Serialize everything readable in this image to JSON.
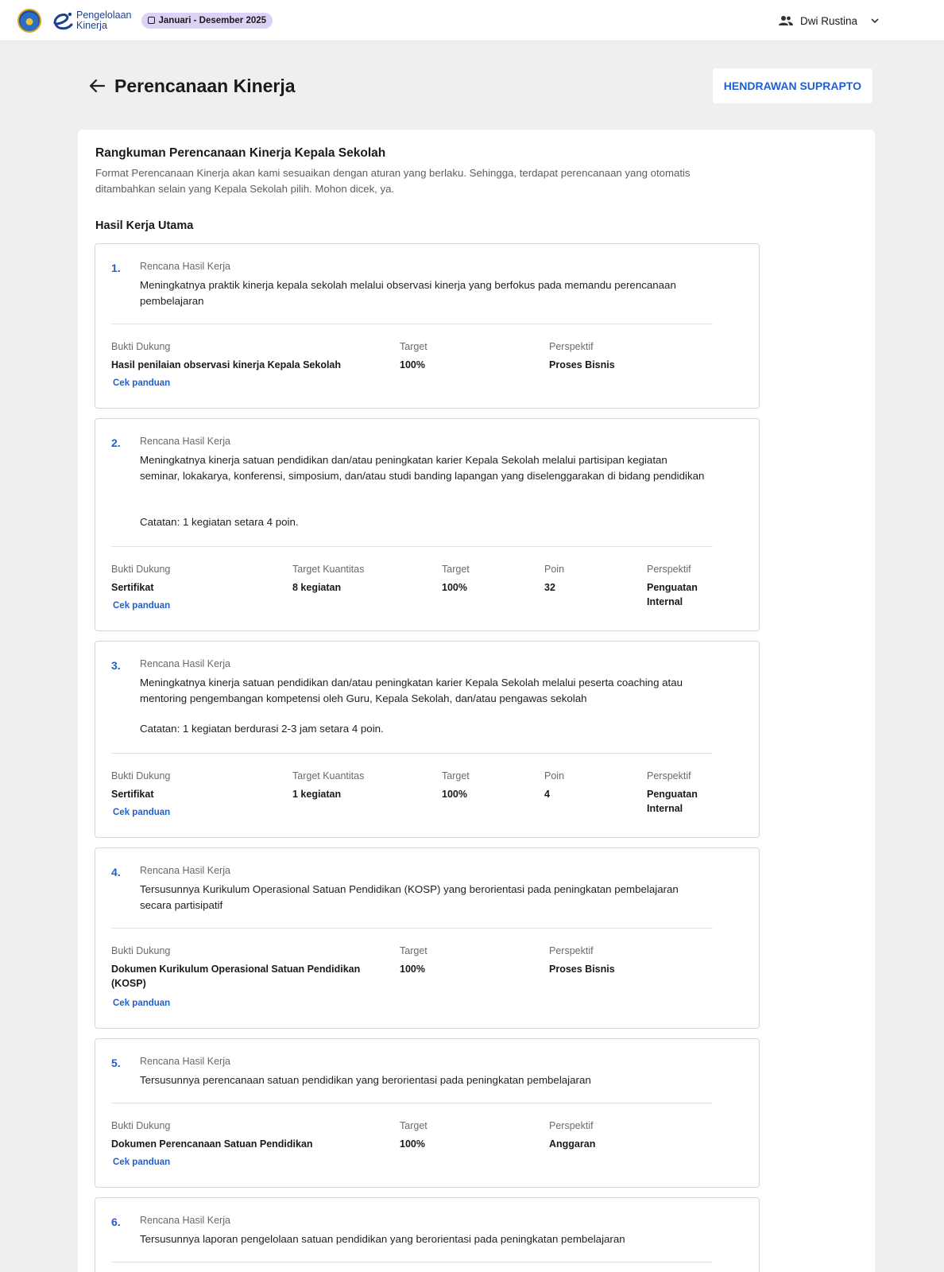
{
  "header": {
    "brand_line1": "Pengelolaan",
    "brand_line2": "Kinerja",
    "period": "Januari - Desember 2025",
    "user_name": "Dwi Rustina"
  },
  "page": {
    "title": "Perencanaan Kinerja",
    "assessee_button": "HENDRAWAN SUPRAPTO"
  },
  "summary": {
    "title": "Rangkuman Perencanaan Kinerja Kepala Sekolah",
    "description": "Format Perencanaan Kinerja akan kami sesuaikan dengan aturan yang berlaku. Sehingga, terdapat perencanaan yang otomatis ditambahkan selain yang Kepala Sekolah pilih. Mohon dicek, ya.",
    "section_title": "Hasil Kerja Utama"
  },
  "labels": {
    "plan": "Rencana Hasil Kerja",
    "evidence": "Bukti Dukung",
    "target_qty": "Target Kuantitas",
    "target": "Target",
    "points": "Poin",
    "perspective": "Perspektif",
    "guide": "Cek panduan"
  },
  "items": [
    {
      "number": "1.",
      "description": "Meningkatnya praktik kinerja kepala sekolah melalui observasi kinerja yang berfokus pada memandu perencanaan pembelajaran",
      "note": "",
      "evidence": "Hasil penilaian observasi kinerja Kepala Sekolah",
      "target_qty": "",
      "target": "100%",
      "points": "",
      "perspective": "Proses Bisnis"
    },
    {
      "number": "2.",
      "description": "Meningkatnya kinerja satuan pendidikan dan/atau peningkatan karier Kepala Sekolah melalui partisipan kegiatan seminar, lokakarya, konferensi, simposium, dan/atau studi banding lapangan yang diselenggarakan di bidang pendidikan",
      "note": "Catatan: 1 kegiatan setara 4 poin.",
      "evidence": "Sertifikat",
      "target_qty": "8 kegiatan",
      "target": "100%",
      "points": "32",
      "perspective": "Penguatan Internal"
    },
    {
      "number": "3.",
      "description": "Meningkatnya kinerja satuan pendidikan dan/atau peningkatan karier Kepala Sekolah melalui peserta coaching atau mentoring pengembangan kompetensi oleh Guru, Kepala Sekolah, dan/atau pengawas sekolah",
      "note": "Catatan: 1 kegiatan berdurasi 2-3 jam setara 4 poin.",
      "evidence": "Sertifikat",
      "target_qty": "1 kegiatan",
      "target": "100%",
      "points": "4",
      "perspective": "Penguatan Internal"
    },
    {
      "number": "4.",
      "description": "Tersusunnya Kurikulum Operasional Satuan Pendidikan (KOSP) yang berorientasi pada peningkatan pembelajaran secara partisipatif",
      "note": "",
      "evidence": "Dokumen Kurikulum Operasional Satuan Pendidikan (KOSP)",
      "target_qty": "",
      "target": "100%",
      "points": "",
      "perspective": "Proses Bisnis"
    },
    {
      "number": "5.",
      "description": "Tersusunnya perencanaan satuan pendidikan yang berorientasi pada peningkatan pembelajaran",
      "note": "",
      "evidence": "Dokumen Perencanaan Satuan Pendidikan",
      "target_qty": "",
      "target": "100%",
      "points": "",
      "perspective": "Anggaran"
    },
    {
      "number": "6.",
      "description": "Tersusunnya laporan pengelolaan satuan pendidikan yang berorientasi pada peningkatan pembelajaran",
      "note": "",
      "evidence": "",
      "target_qty": "",
      "target": "",
      "points": "",
      "perspective": ""
    }
  ]
}
